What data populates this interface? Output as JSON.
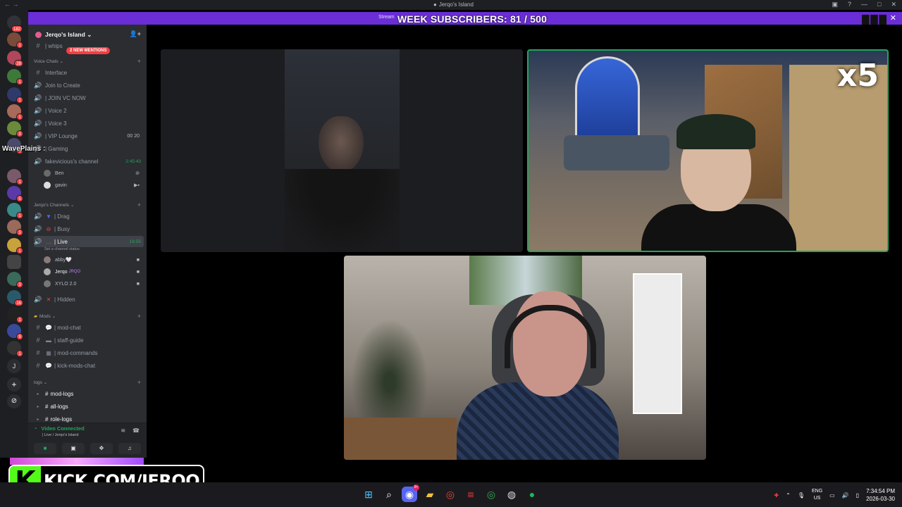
{
  "window": {
    "title": "Jerqo's Island",
    "back_icon": "←",
    "forward_icon": "→"
  },
  "banner": {
    "subscribers_text": "WEEK SUBSCRIBERS: 81 / 500",
    "streamer_prefix": "Stream",
    "close_icon": "✕",
    "bars_text": "▮▮▮"
  },
  "server_rail": {
    "home_badge": "182",
    "badges": [
      "1",
      "28",
      "1",
      "1",
      "1",
      "3",
      "6",
      "1",
      "5",
      "1",
      "3",
      "1",
      "3",
      "16",
      "1",
      "9",
      "1"
    ]
  },
  "guild": {
    "name": "Jerqo's Island",
    "mention_pill": "2 NEW MENTIONS",
    "partial_channel": "| whips"
  },
  "voice_chats": {
    "category": "Voice Chats",
    "channels": [
      {
        "name": "Interface",
        "icon": "#"
      },
      {
        "name": "Join to Create",
        "icon": "🔊"
      },
      {
        "name": "| JOIN VC NOW",
        "icon": "🔊"
      },
      {
        "name": "| Voice 2",
        "icon": "🔊"
      },
      {
        "name": "| Voice 3",
        "icon": "🔊"
      },
      {
        "name": "| VIP Lounge",
        "icon": "🔊",
        "counts": "00 20"
      },
      {
        "name": "| Gaming",
        "icon": "🔊"
      },
      {
        "name": "fakevicious's channel",
        "icon": "🔊",
        "time": "2:45:43"
      }
    ],
    "users": [
      {
        "name": "Ben"
      },
      {
        "name": "gavin"
      }
    ]
  },
  "jerqos_channels": {
    "category": "Jerqo's Channels",
    "channels": [
      {
        "name": "| Drag"
      },
      {
        "name": "| Busy"
      },
      {
        "name": "| Live",
        "time": "16:55",
        "status": "Set a channel status"
      }
    ],
    "live_users": [
      {
        "name": "abby🤍"
      },
      {
        "name": "Jerqo",
        "tag": "JRQO"
      },
      {
        "name": "XYLO 2.0"
      }
    ],
    "hidden": "| Hidden"
  },
  "mods": {
    "category": "Mods",
    "channels": [
      {
        "name": "| mod-chat"
      },
      {
        "name": "| staff-guide"
      },
      {
        "name": "| mod-commands"
      },
      {
        "name": "| kick-mods-chat"
      }
    ]
  },
  "logs": {
    "category": "logs",
    "channels": [
      {
        "name": "mod-logs"
      },
      {
        "name": "all-logs"
      },
      {
        "name": "role-logs"
      }
    ]
  },
  "voice_panel": {
    "status": "Video Connected",
    "location": "| Live / Jerqo's Island"
  },
  "overlay": {
    "wave_label": "WavePlains :",
    "multiplier": "x5",
    "kick_url": "KICK.COM/JERQO",
    "kick_letter": "K"
  },
  "taskbar": {
    "discord_badge": "9+",
    "lang_top": "ENG",
    "lang_bottom": "US",
    "time": "7:34:54 PM",
    "date": "2026-03-30"
  },
  "colors": {
    "accent_purple": "#6a2dd6",
    "speaking_green": "#23a55a",
    "kick_green": "#53fc18",
    "mention_red": "#f23f43"
  }
}
